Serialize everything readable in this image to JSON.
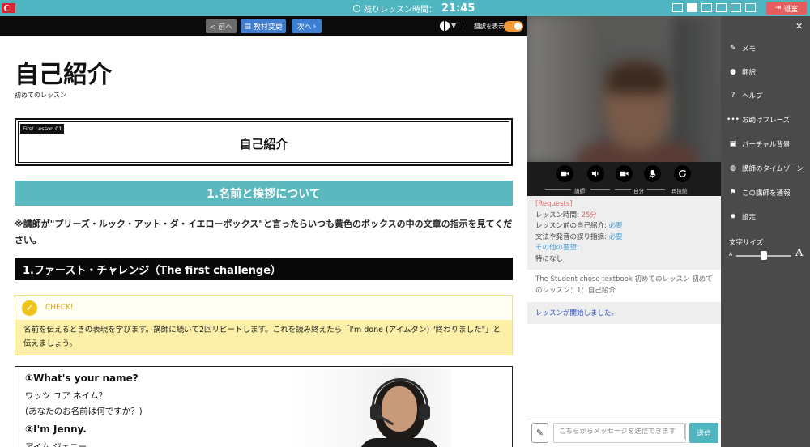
{
  "topbar": {
    "timer_label": "残りレッスン時間：",
    "timer_value": "21:45",
    "exit_label": "退室"
  },
  "toolbar": {
    "prev_label": "< 前へ",
    "material_label": "教材変更",
    "next_label": "次へ",
    "translation_label": "翻訳を表示",
    "translation_on": true
  },
  "content": {
    "page_title": "自己紹介",
    "page_subtitle": "初めてのレッスン",
    "lesson_tag": "First Lesson 01",
    "lesson_box_title": "自己紹介",
    "section_header": "1.名前と挨拶について",
    "note": "※講師が\"プリーズ・ルック・アット・ダ・イエローボックス\"と言ったらいつも黄色のボックスの中の文章の指示を見てください。",
    "challenge_title": "1.ファースト・チャレンジ（The first challenge）",
    "check_label": "CHECK!",
    "check_body": "名前を伝えるときの表現を学びます。講師に続いて2回リピートします。これを読み終えたら「I'm done (アイムダン) \"終わりました\"」と伝えましょう。",
    "dialog": {
      "q1": "①What's your name?",
      "q1_kana": "ワッツ ユア ネイム？",
      "q1_ja": "(あなたのお名前は何ですか？)",
      "q2": "②I'm Jenny.",
      "q2_kana": "アイム ジェニー"
    }
  },
  "controls": {
    "tutor_label": "講師",
    "self_label": "自分",
    "reconnect_label": "再接続"
  },
  "chat": {
    "requests_title": "[Requests]",
    "lesson_time_label": "レッスン時間: ",
    "lesson_time_value": "25分",
    "intro_label": "レッスン前の自己紹介: ",
    "intro_value": "必要",
    "correction_label": "文法や発音の誤り指摘: ",
    "correction_value": "必要",
    "other_label": "その他の要望:",
    "other_value": "特になし",
    "message_textbook": "The Student chose textbook 初めてのレッスン 初めてのレッスン：1：自己紹介",
    "message_started": "レッスンが開始しました。",
    "input_placeholder": "こちらからメッセージを送信できます",
    "send_label": "送信"
  },
  "sidebar": {
    "items": [
      {
        "label": "メモ",
        "icon": "edit-icon"
      },
      {
        "label": "翻訳",
        "icon": "globe-icon"
      },
      {
        "label": "ヘルプ",
        "icon": "help-icon"
      },
      {
        "label": "お助けフレーズ",
        "icon": "speech-bubble-icon"
      },
      {
        "label": "バーチャル背景",
        "icon": "image-icon"
      },
      {
        "label": "講師のタイムゾーン",
        "icon": "world-icon"
      },
      {
        "label": "この講師を通報",
        "icon": "flag-icon"
      },
      {
        "label": "設定",
        "icon": "gear-icon"
      }
    ],
    "font_size_label": "文字サイズ",
    "font_small": "A",
    "font_large": "A",
    "font_size_level": 0.45
  },
  "colors": {
    "accent_teal": "#4fb6c1",
    "button_blue": "#3e7ed3",
    "exit_red": "#e65d5d",
    "toggle_orange": "#f29a38",
    "check_yellow": "#fcf0a8"
  }
}
